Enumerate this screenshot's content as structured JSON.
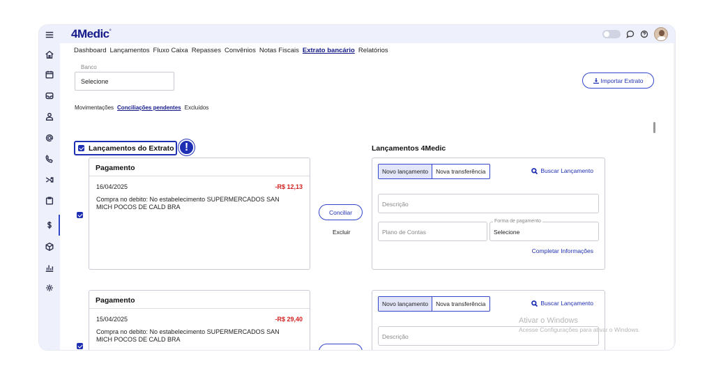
{
  "app": {
    "logo_text": "4Medic",
    "logo_mark": "4",
    "logo_rest": "Medic"
  },
  "sidebar": {
    "icons": [
      "menu-icon",
      "home-icon",
      "calendar-icon",
      "inbox-icon",
      "user-icon",
      "at-icon",
      "phone-icon",
      "shuffle-icon",
      "clipboard-icon",
      "dollar-icon",
      "box-icon",
      "chart-icon",
      "settings-icon"
    ],
    "active_item": "dollar-icon"
  },
  "topbar": {
    "icons": [
      "theme-toggle",
      "chat-icon",
      "help-icon",
      "avatar"
    ]
  },
  "nav": {
    "items": [
      "Dashboard",
      "Lançamentos",
      "Fluxo Caixa",
      "Repasses",
      "Convênios",
      "Notas Fiscais",
      "Extrato bancário",
      "Relatórios"
    ],
    "active": "Extrato bancário"
  },
  "banco": {
    "label": "Banco",
    "value": "Selecione"
  },
  "import_button": {
    "label": "Importar Extrato"
  },
  "subtabs": {
    "items": [
      "Movimentações",
      "Conciliações pendentes",
      "Excluídos"
    ],
    "active": "Conciliações pendentes"
  },
  "extrato": {
    "title": "Lançamentos do Extrato",
    "alert": "!"
  },
  "medic": {
    "title": "Lançamentos 4Medic"
  },
  "entries": [
    {
      "title": "Pagamento",
      "date": "16/04/2025",
      "amount": "-R$ 12,13",
      "description": "Compra no debito: No estabelecimento SUPERMERCADOS SAN MICH POCOS DE CALD BRA"
    },
    {
      "title": "Pagamento",
      "date": "15/04/2025",
      "amount": "-R$ 29,40",
      "description": "Compra no debito: No estabelecimento SUPERMERCADOS SAN MICH POCOS DE CALD BRA"
    }
  ],
  "actions": {
    "conciliar": "Conciliar",
    "excluir": "Excluir"
  },
  "form": {
    "novo": "Novo lançamento",
    "transfer": "Nova transferência",
    "buscar": "Buscar Lançamento",
    "descricao_ph": "Descrição",
    "plano_ph": "Plano de Contas",
    "forma_label": "Forma de pagamento",
    "forma_value": "Selecione",
    "completar": "Completar Informações"
  },
  "watermark": {
    "line1": "Ativar o Windows",
    "line2": "Acesse Configurações para ativar o Windows."
  },
  "colors": {
    "accent": "#1e2fb3",
    "negative": "#d21f1f",
    "rail": "#eef0fb"
  }
}
